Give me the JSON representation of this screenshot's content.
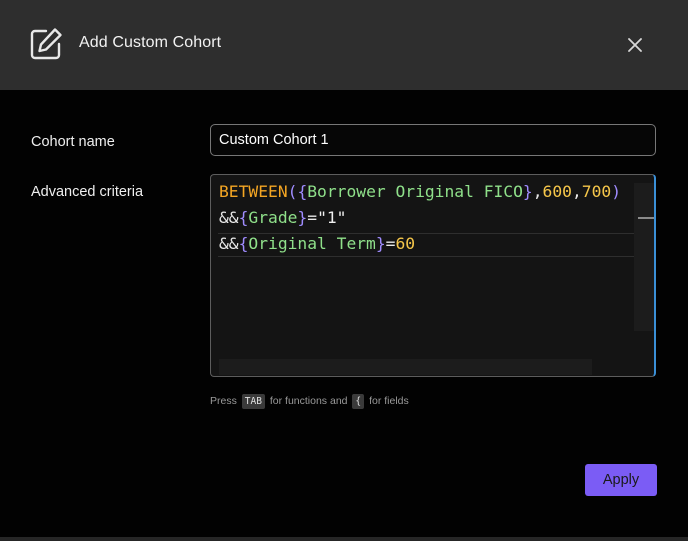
{
  "dialog": {
    "title": "Add Custom Cohort",
    "header_icon": "edit-icon",
    "close_icon": "close-icon"
  },
  "form": {
    "cohort_name_label": "Cohort name",
    "cohort_name_value": "Custom Cohort 1",
    "criteria_label": "Advanced criteria",
    "criteria_lines": [
      [
        {
          "t": "BETWEEN",
          "k": "fn"
        },
        {
          "t": "(",
          "k": "brace"
        },
        {
          "t": "{",
          "k": "brace"
        },
        {
          "t": "Borrower Original FICO",
          "k": "field"
        },
        {
          "t": "}",
          "k": "brace"
        },
        {
          "t": ",",
          "k": "op"
        },
        {
          "t": "600",
          "k": "num"
        },
        {
          "t": ",",
          "k": "op"
        },
        {
          "t": "700",
          "k": "num"
        },
        {
          "t": ")",
          "k": "brace"
        }
      ],
      [
        {
          "t": "&&",
          "k": "op"
        },
        {
          "t": "{",
          "k": "brace"
        },
        {
          "t": "Grade",
          "k": "field"
        },
        {
          "t": "}",
          "k": "brace"
        },
        {
          "t": "=",
          "k": "op"
        },
        {
          "t": "\"1\"",
          "k": "str"
        }
      ],
      [
        {
          "t": "&&",
          "k": "op"
        },
        {
          "t": "{",
          "k": "brace"
        },
        {
          "t": "Original Term",
          "k": "field"
        },
        {
          "t": "}",
          "k": "brace"
        },
        {
          "t": "=",
          "k": "op"
        },
        {
          "t": "60",
          "k": "num"
        }
      ]
    ]
  },
  "hint": {
    "prefix": "Press",
    "tab_key": "TAB",
    "middle": "for functions and",
    "brace_key": "{",
    "suffix": "for fields"
  },
  "actions": {
    "apply_label": "Apply"
  },
  "colors": {
    "accent": "#7b5cf5",
    "function": "#f5a623",
    "brace": "#a08cff",
    "field": "#8fe08a",
    "number": "#f5c64a"
  }
}
